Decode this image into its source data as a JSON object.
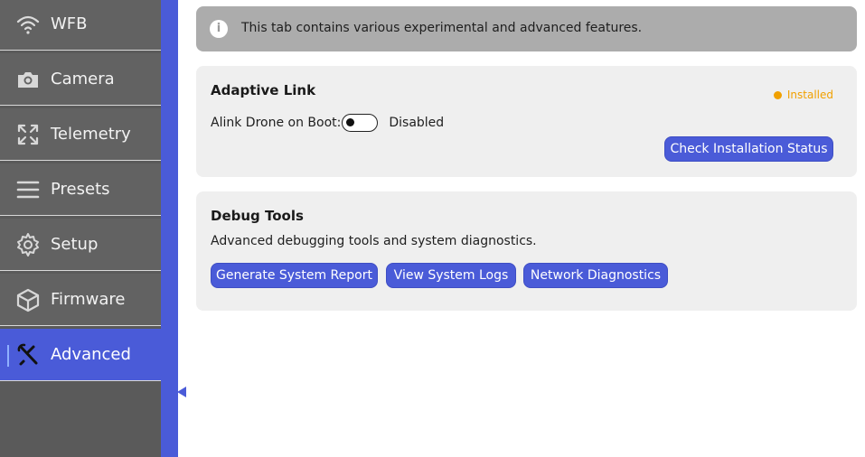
{
  "sidebar": {
    "items": [
      {
        "label": "WFB",
        "icon": "wifi-icon"
      },
      {
        "label": "Camera",
        "icon": "camera-icon"
      },
      {
        "label": "Telemetry",
        "icon": "expand-arrows-icon"
      },
      {
        "label": "Presets",
        "icon": "menu-lines-icon"
      },
      {
        "label": "Setup",
        "icon": "gear-icon"
      },
      {
        "label": "Firmware",
        "icon": "box-icon"
      },
      {
        "label": "Advanced",
        "icon": "wrench-screwdriver-icon",
        "active": true
      }
    ]
  },
  "info": {
    "text": "This tab contains various experimental and advanced features."
  },
  "adaptive_link": {
    "title": "Adaptive Link",
    "status": "Installed",
    "toggle_label": "Alink Drone on Boot:",
    "toggle_state": "Disabled",
    "check_button": "Check Installation Status"
  },
  "debug_tools": {
    "title": "Debug Tools",
    "description": "Advanced debugging tools and system diagnostics.",
    "buttons": [
      "Generate System Report",
      "View System Logs",
      "Network Diagnostics"
    ]
  },
  "colors": {
    "accent": "#4a5bd8",
    "sidebar": "#626262",
    "status_installed": "#f0a000"
  }
}
